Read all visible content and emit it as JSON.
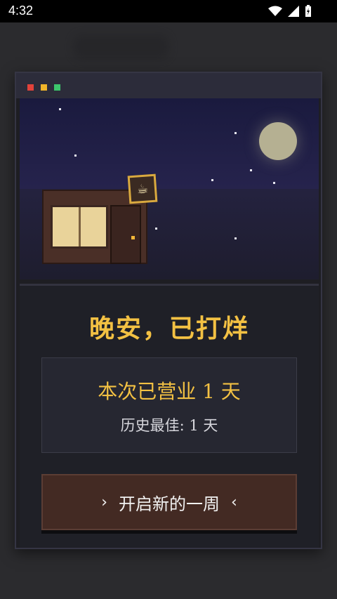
{
  "status_bar": {
    "time": "4:32",
    "icons": [
      "wifi-icon",
      "signal-icon",
      "battery-charging-icon"
    ]
  },
  "window": {
    "controls": [
      "red",
      "yellow",
      "green"
    ]
  },
  "scene": {
    "sign_icon": "coffee-cup-icon",
    "sign_glyph": "☕"
  },
  "panel": {
    "headline": "晚安，已打烊",
    "stats_main": "本次已营业 1 天",
    "stats_sub": "历史最佳: 1 天",
    "button_left_arrow": "›",
    "button_label": "开启新的一周",
    "button_right_arrow": "‹"
  },
  "colors": {
    "accent": "#f3c143",
    "button_bg": "#432a23",
    "window_bg": "#1e1e23"
  }
}
